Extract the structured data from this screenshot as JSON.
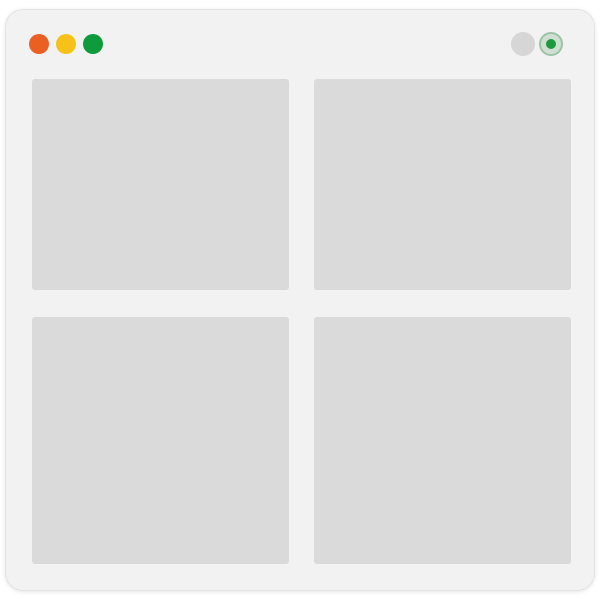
{
  "window": {
    "controls": [
      "close-icon",
      "minimize-icon",
      "maximize-icon"
    ],
    "right_controls": [
      "circle-icon",
      "status-icon"
    ]
  },
  "colors": {
    "close": "#ec5f23",
    "minimize": "#f6c21a",
    "maximize": "#0e9b3b",
    "tile": "#dadada",
    "window_bg": "#f2f2f2",
    "status_accent": "#1d9a3d"
  },
  "grid": {
    "tiles": [
      {
        "name": "tile-1"
      },
      {
        "name": "tile-2"
      },
      {
        "name": "tile-3"
      },
      {
        "name": "tile-4"
      }
    ]
  }
}
